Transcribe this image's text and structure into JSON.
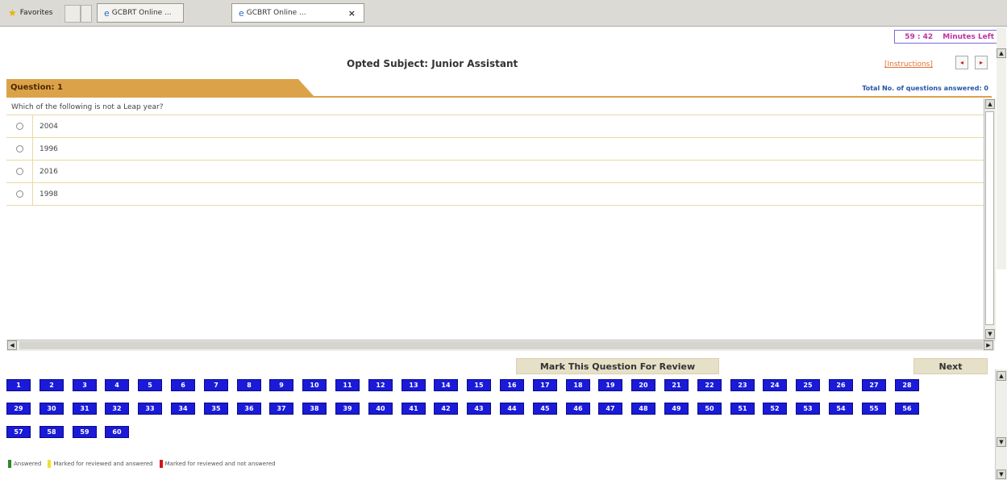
{
  "browser": {
    "favorites_label": "Favorites",
    "tabs": [
      {
        "label": "GCBRT Online ..."
      },
      {
        "label": "GCBRT Online ..."
      }
    ],
    "close_symbol": "×"
  },
  "timer": {
    "value": "59 : 42",
    "suffix": "Minutes Left"
  },
  "header": {
    "subject": "Opted Subject: Junior Assistant",
    "instructions_link": "[Instructions]",
    "prev_symbol": "◂",
    "next_symbol": "▸"
  },
  "question": {
    "label": "Question: 1",
    "answered_text": "Total No. of questions answered: 0",
    "text": "Which of the following is not a Leap year?",
    "options": [
      "2004",
      "1996",
      "2016",
      "1998"
    ]
  },
  "actions": {
    "review_label": "Mark This Question For Review",
    "next_label": "Next"
  },
  "palette": {
    "numbers": [
      "1",
      "2",
      "3",
      "4",
      "5",
      "6",
      "7",
      "8",
      "9",
      "10",
      "11",
      "12",
      "13",
      "14",
      "15",
      "16",
      "17",
      "18",
      "19",
      "20",
      "21",
      "22",
      "23",
      "24",
      "25",
      "26",
      "27",
      "28",
      "29",
      "30",
      "31",
      "32",
      "33",
      "34",
      "35",
      "36",
      "37",
      "38",
      "39",
      "40",
      "41",
      "42",
      "43",
      "44",
      "45",
      "46",
      "47",
      "48",
      "49",
      "50",
      "51",
      "52",
      "53",
      "54",
      "55",
      "56",
      "57",
      "58",
      "59",
      "60"
    ],
    "color": "#1a1ad8"
  },
  "legend": [
    {
      "label": "Answered",
      "color": "#2a8a2a"
    },
    {
      "label": "Marked for reviewed and answered",
      "color": "#f2e030"
    },
    {
      "label": "Marked for reviewed and not answered",
      "color": "#d01818"
    }
  ]
}
